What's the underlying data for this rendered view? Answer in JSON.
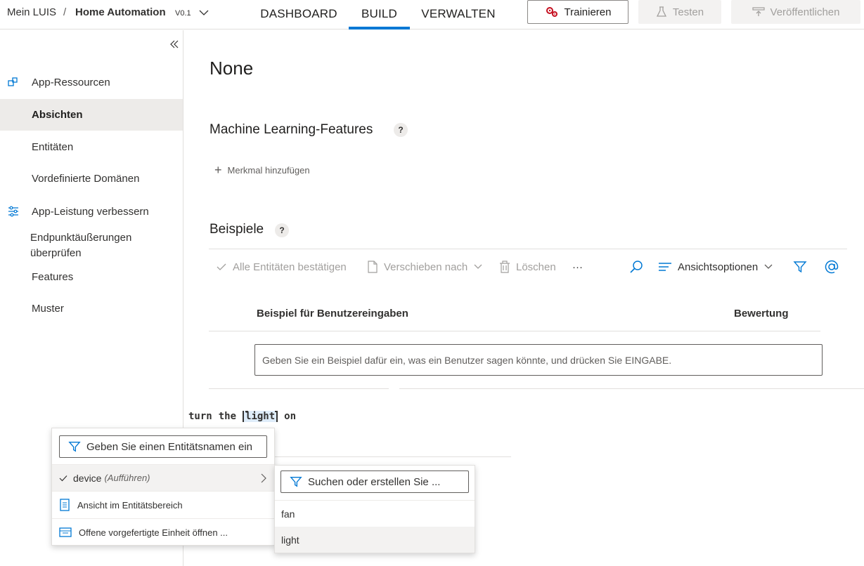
{
  "header": {
    "breadcrumb_root": "Mein LUIS",
    "separator": "/",
    "app_name": "Home Automation",
    "version": "V0.1",
    "tabs": [
      {
        "label": "DASHBOARD",
        "active": false
      },
      {
        "label": "BUILD",
        "active": true
      },
      {
        "label": "VERWALTEN",
        "active": false
      }
    ],
    "train_label": "Trainieren",
    "test_label": "Testen",
    "publish_label": "Veröffentlichen"
  },
  "sidebar": {
    "items": [
      {
        "label": "App-Ressourcen",
        "icon": "resources-icon",
        "selected": false
      },
      {
        "label": "Absichten",
        "selected": true
      },
      {
        "label": "Entitäten",
        "selected": false
      },
      {
        "label": "Vordefinierte Domänen",
        "selected": false
      },
      {
        "label": "App-Leistung verbessern",
        "icon": "sliders-icon",
        "selected": false
      },
      {
        "label": "Endpunktäußerungen überprüfen",
        "selected": false
      },
      {
        "label": "Features",
        "selected": false
      },
      {
        "label": "Muster",
        "selected": false
      }
    ]
  },
  "main": {
    "intent_title": "None",
    "ml_features_title": "Machine Learning-Features",
    "help": "?",
    "add_feature_label": "Merkmal hinzufügen",
    "examples_title": "Beispiele",
    "toolbar": {
      "confirm_all": "Alle Entitäten bestätigen",
      "move_to": "Verschieben nach",
      "delete": "Löschen",
      "more": "···",
      "view_options": "Ansichtsoptionen"
    },
    "table": {
      "col_example": "Beispiel für Benutzereingaben",
      "col_score": "Bewertung"
    },
    "utterance_placeholder": "Geben Sie ein Beispiel dafür ein, was ein Benutzer sagen könnte, und drücken Sie EINGABE.",
    "utterance_tokens": [
      "turn",
      "the",
      "light",
      "on"
    ],
    "selected_token": "light"
  },
  "entity_menu": {
    "filter_placeholder": "Geben Sie einen Entitätsnamen ein",
    "entity_name": "device",
    "entity_type": "(Aufführen)",
    "view_in_panel": "Ansicht im Entitätsbereich",
    "open_prebuilt": "Offene vorgefertigte Einheit öffnen ..."
  },
  "submenu": {
    "search_placeholder": "Suchen oder erstellen Sie ...",
    "items": [
      "fan",
      "light"
    ]
  },
  "colors": {
    "accent": "#0078d4",
    "train_icon": "#c50f1f",
    "token_highlight": "#deecf9"
  }
}
